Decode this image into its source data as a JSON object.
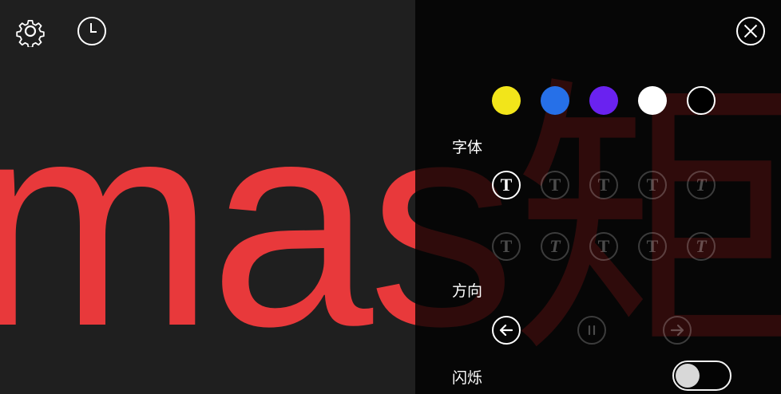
{
  "marquee": {
    "text_main": "mas",
    "text_tail": "矩",
    "color": "#e8393b"
  },
  "toolbar": {
    "settings_icon": "gear-icon",
    "history_icon": "clock-icon",
    "close_icon": "close-icon"
  },
  "colors": {
    "swatches": [
      "#f2e51a",
      "#2670e8",
      "#6a22f0",
      "#ffffff",
      "#000000"
    ]
  },
  "font_section": {
    "label": "字体",
    "options_row1": [
      "T",
      "T",
      "T",
      "T",
      "T"
    ],
    "options_row2": [
      "T",
      "T",
      "T",
      "T",
      "T"
    ],
    "selected_index": 0
  },
  "direction_section": {
    "label": "方向",
    "options": [
      "arrow-left-icon",
      "pause-icon",
      "arrow-right-icon"
    ],
    "selected_index": 0
  },
  "blink_section": {
    "label": "闪烁",
    "enabled": false
  }
}
